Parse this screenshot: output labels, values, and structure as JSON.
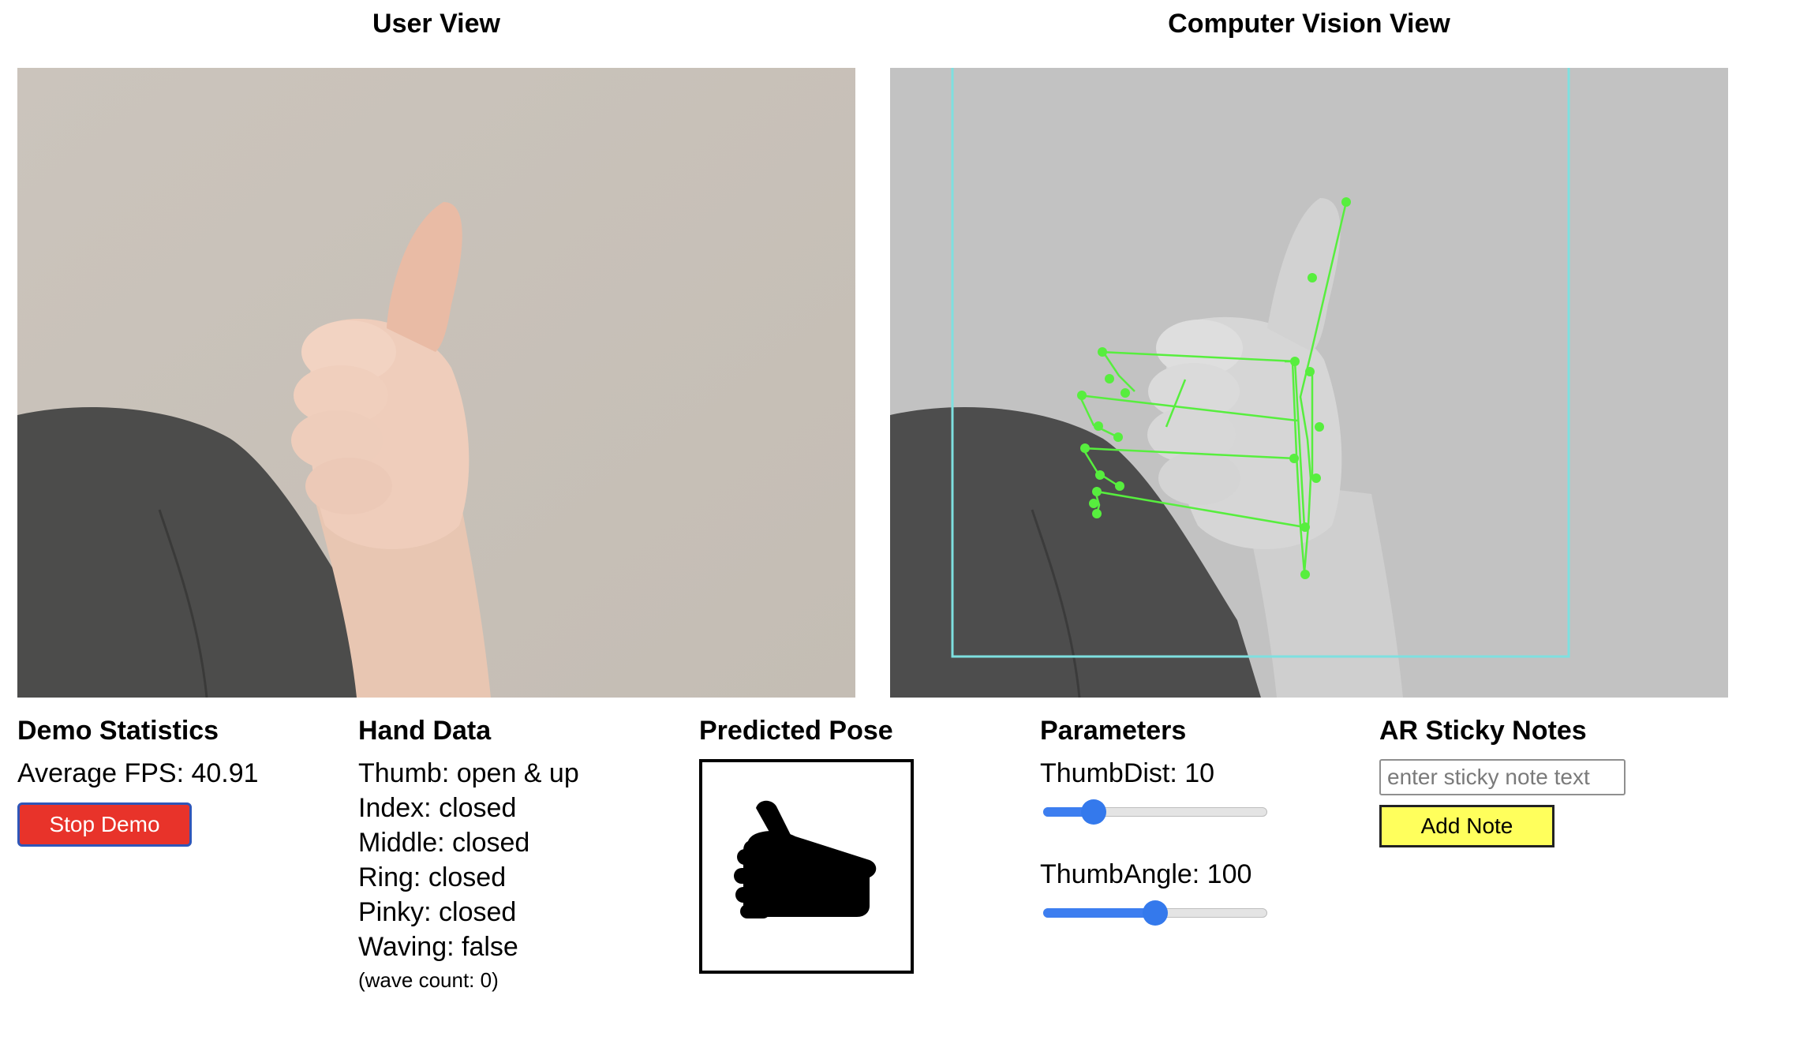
{
  "views": {
    "user_title": "User View",
    "cv_title": "Computer Vision View"
  },
  "stats": {
    "title": "Demo Statistics",
    "fps_label": "Average FPS: 40.91",
    "stop_button": "Stop Demo"
  },
  "hand_data": {
    "title": "Hand Data",
    "lines": [
      "Thumb: open & up",
      "Index: closed",
      "Middle: closed",
      "Ring: closed",
      "Pinky: closed",
      "Waving: false"
    ],
    "wave_count": "(wave count: 0)"
  },
  "predicted_pose": {
    "title": "Predicted Pose",
    "icon": "thumbs-up-icon"
  },
  "parameters": {
    "title": "Parameters",
    "thumb_dist_label": "ThumbDist: 10",
    "thumb_dist_position": 0.19,
    "thumb_angle_label": "ThumbAngle: 100",
    "thumb_angle_position": 0.5
  },
  "sticky_notes": {
    "title": "AR Sticky Notes",
    "input_placeholder": "enter sticky note text",
    "input_value": "",
    "add_button": "Add Note"
  },
  "colors": {
    "landmark": "#57ee3e",
    "bbox": "#7ee0e0",
    "stop_button": "#e8332a",
    "add_button": "#ffff5c",
    "slider": "#3479ec"
  }
}
